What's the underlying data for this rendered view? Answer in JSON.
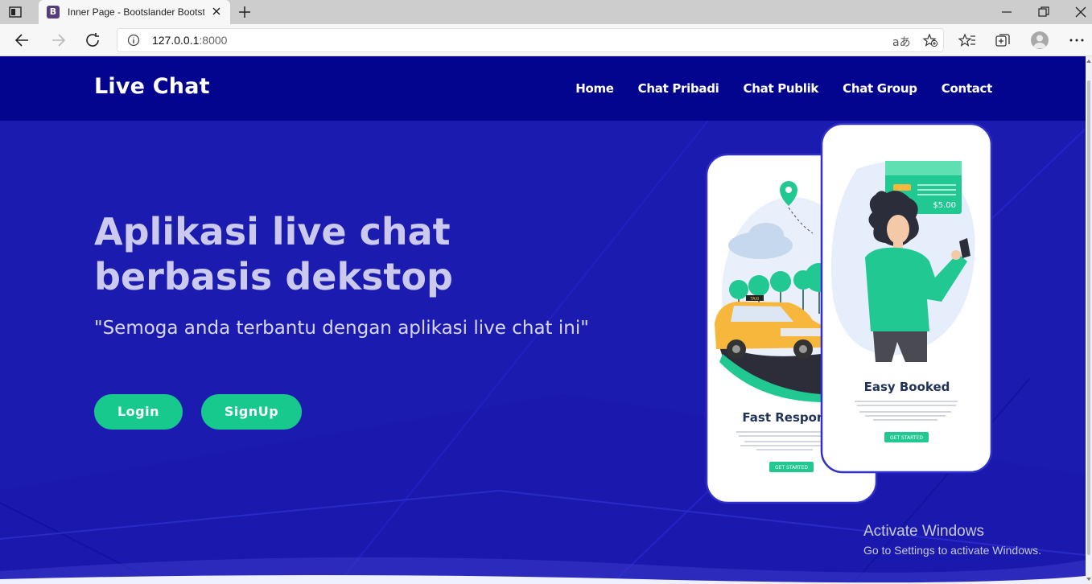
{
  "browser": {
    "tab_title": "Inner Page - Bootslander Bootstrap Template",
    "favicon_letter": "B",
    "url_host": "127.0.0.1",
    "url_port": ":8000",
    "read_aloud_label": "aあ"
  },
  "site": {
    "brand": "Live Chat",
    "nav": [
      {
        "label": "Home"
      },
      {
        "label": "Chat Pribadi"
      },
      {
        "label": "Chat Publik"
      },
      {
        "label": "Chat Group"
      },
      {
        "label": "Contact"
      }
    ]
  },
  "hero": {
    "title_line1": "Aplikasi live chat",
    "title_line2": "berbasis dekstop",
    "subtitle": "\"Semoga anda terbantu dengan aplikasi live chat ini\"",
    "login_label": "Login",
    "signup_label": "SignUp"
  },
  "illustration": {
    "left_phone_heading": "Fast Respon",
    "left_phone_button": "GET STARTED",
    "right_phone_heading": "Easy Booked",
    "right_phone_button": "GET STARTED",
    "price_tag": "$5.00",
    "taxi_sign": "TAXI"
  },
  "watermark": {
    "title": "Activate Windows",
    "subtitle": "Go to Settings to activate Windows."
  },
  "colors": {
    "navbar": "#04058f",
    "hero_bg": "#1b1bb0",
    "accent_green": "#18c98d",
    "title_text": "#cbc9ee"
  }
}
